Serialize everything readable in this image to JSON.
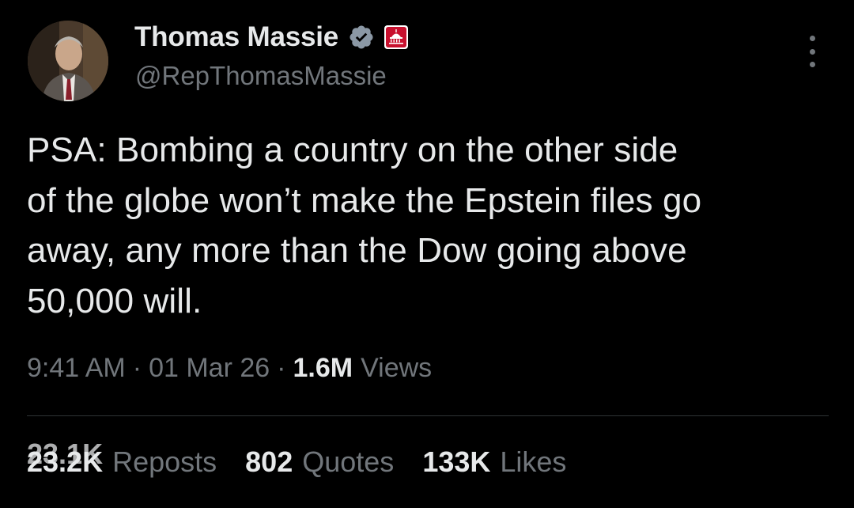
{
  "author": {
    "display_name": "Thomas Massie",
    "handle": "@RepThomasMassie",
    "avatar_icon": "profile-photo",
    "verified_icon": "verified-badge-icon",
    "affiliation_icon": "capitol-building-icon"
  },
  "tweet": {
    "text_lines": [
      "PSA: Bombing a country on the other side",
      "of the globe won’t make the Epstein files go",
      "away, any more than the Dow going above",
      "50,000 will."
    ]
  },
  "meta": {
    "time": "9:41 AM",
    "separator": "·",
    "date": "01 Mar 26",
    "views_count": "1.6M",
    "views_label": "Views"
  },
  "stats": {
    "reposts_count": "23.2K",
    "reposts_count_ghost": "23.1K",
    "reposts_label": "Reposts",
    "quotes_count": "802",
    "quotes_label": "Quotes",
    "likes_count": "133K",
    "likes_label": "Likes"
  },
  "colors": {
    "background": "#000000",
    "primary_text": "#e7e9ea",
    "secondary_text": "#71767b",
    "verified_blue": "#1d9bf0",
    "affiliation_red": "#c8102e",
    "divider": "#2f3336"
  }
}
